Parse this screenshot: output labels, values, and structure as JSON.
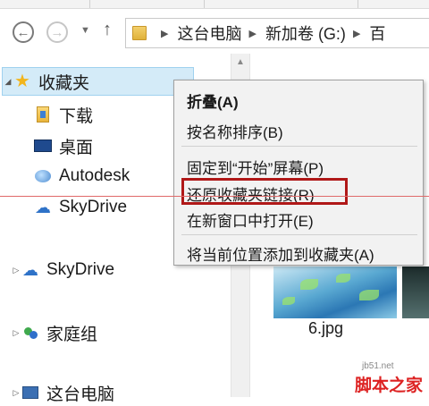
{
  "address_bar": {
    "breadcrumbs": [
      "这台电脑",
      "新加卷 (G:)",
      "百"
    ]
  },
  "nav_pane": {
    "items": [
      {
        "label": "收藏夹",
        "icon": "star-icon"
      },
      {
        "label": "下载",
        "icon": "downloads-folder-icon"
      },
      {
        "label": "桌面",
        "icon": "desktop-icon"
      },
      {
        "label": "Autodesk",
        "icon": "autodesk-icon"
      },
      {
        "label": "SkyDrive",
        "icon": "cloud-icon"
      },
      {
        "label": "SkyDrive",
        "icon": "cloud-icon"
      },
      {
        "label": "家庭组",
        "icon": "homegroup-icon"
      },
      {
        "label": "这台电脑",
        "icon": "computer-icon"
      }
    ]
  },
  "context_menu": {
    "items": [
      {
        "label": "折叠(A)",
        "bold": true
      },
      {
        "label": "按名称排序(B)"
      },
      {
        "label": "固定到“开始”屏幕(P)"
      },
      {
        "label": "还原收藏夹链接(R)",
        "highlighted": true
      },
      {
        "label": "在新窗口中打开(E)"
      },
      {
        "label": "将当前位置添加到收藏夹(A)"
      }
    ],
    "highlight_color": "#b01818"
  },
  "files": {
    "items": [
      {
        "name": "6.jpg"
      }
    ]
  },
  "watermark": {
    "site": "jb51.net",
    "brand": "脚本之家"
  }
}
